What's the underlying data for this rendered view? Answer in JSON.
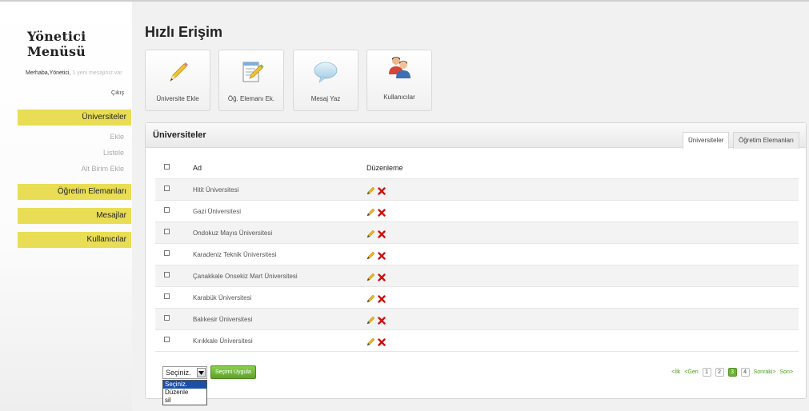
{
  "sidebar": {
    "title": "Yönetici Menüsü",
    "welcome_user": "Merhaba,Yönetici,",
    "welcome_msg": "1 yeni mesajınız var",
    "logout": "Çıkış",
    "menus": [
      {
        "label": "Üniversiteler",
        "subitems": [
          "Ekle",
          "Listele",
          "Alt Birim Ekle"
        ]
      },
      {
        "label": "Öğretim Elemanları"
      },
      {
        "label": "Mesajlar"
      },
      {
        "label": "Kullanıcılar"
      }
    ]
  },
  "quick_access": {
    "title": "Hızlı Erişim",
    "buttons": [
      {
        "label": "Üniversite Ekle",
        "icon": "pencil-icon"
      },
      {
        "label": "Öğ. Elemanı Ek.",
        "icon": "notepad-edit-icon"
      },
      {
        "label": "Mesaj Yaz",
        "icon": "speech-bubble-icon"
      },
      {
        "label": "Kullanıcılar",
        "icon": "users-icon"
      }
    ]
  },
  "panel": {
    "title": "Üniversiteler",
    "tabs": [
      "Üniversiteler",
      "Öğretim Elemanları"
    ],
    "active_tab": 0,
    "columns": [
      "Ad",
      "Düzenleme"
    ],
    "rows": [
      "Hitit Üniversitesi",
      "Gazi Üniversitesi",
      "Ondokuz Mayıs Üniversitesi",
      "Karadeniz Teknik Üniversitesi",
      "Çanakkale Onsekiz Mart Üniversitesi",
      "Karabük Üniversitesi",
      "Balıkesir Üniversitesi",
      "Kırıkkale Üniversitesi"
    ]
  },
  "bulk": {
    "selected": "Seçiniz.",
    "options": [
      "Seçiniz.",
      "Düzenle",
      "sil"
    ],
    "apply_label": "Seçimi Uygula"
  },
  "pagination": {
    "first": "<İlk",
    "prev": "<Geri",
    "pages": [
      "1",
      "2",
      "3",
      "4"
    ],
    "current": "3",
    "next": "Sonraki>",
    "last": "Son>"
  },
  "colors": {
    "menu_yellow": "#e8dd54",
    "accent_green": "#6cb23a",
    "delete_red": "#cc1111"
  }
}
